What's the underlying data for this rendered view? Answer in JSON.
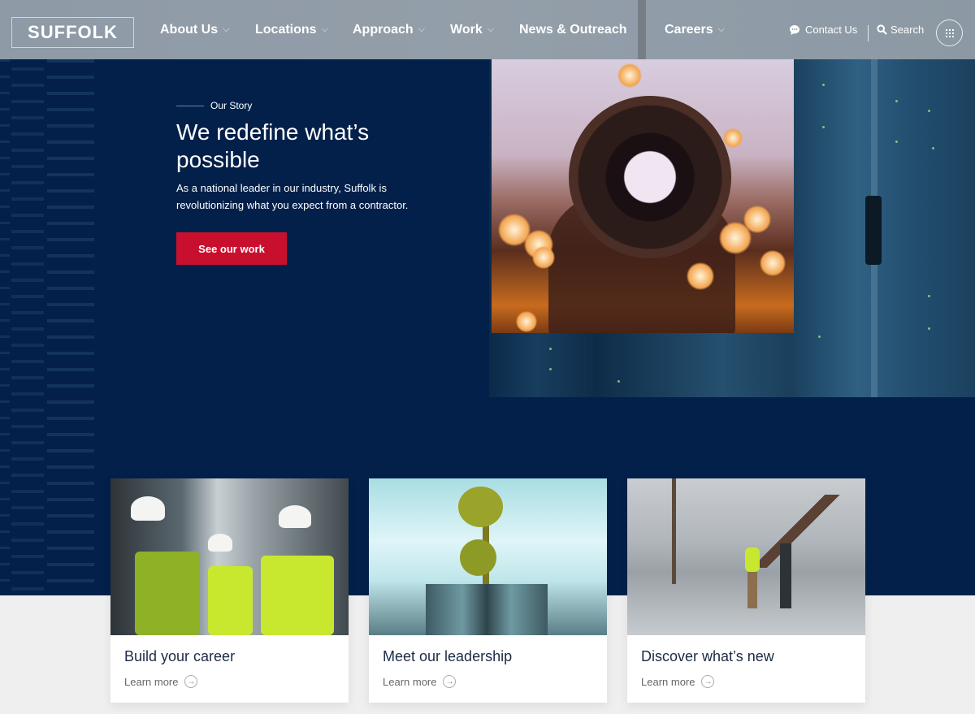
{
  "header": {
    "logo": "SUFFOLK",
    "nav": [
      {
        "label": "About Us",
        "has_dropdown": true
      },
      {
        "label": "Locations",
        "has_dropdown": true
      },
      {
        "label": "Approach",
        "has_dropdown": true
      },
      {
        "label": "Work",
        "has_dropdown": true
      },
      {
        "label": "News & Outreach",
        "has_dropdown": false
      },
      {
        "label": "Careers",
        "has_dropdown": true
      }
    ],
    "contact_label": "Contact Us",
    "search_label": "Search",
    "chevron": "⌵",
    "icons": {
      "contact": "chat-bubble-icon",
      "search": "search-icon",
      "menu": "grid-menu-icon"
    }
  },
  "hero": {
    "eyebrow": "Our Story",
    "headline": "We redefine what’s possible",
    "body": "As a national leader in our industry, Suffolk is revolutionizing what you expect from a contractor.",
    "cta_label": "See our work"
  },
  "cards": [
    {
      "title": "Build your career",
      "link": "Learn more",
      "image": "construction workers in hard hats and safety vests"
    },
    {
      "title": "Meet our leadership",
      "link": "Learn more",
      "image": "escalators beneath glass atrium with golden flower sculpture"
    },
    {
      "title": "Discover what’s new",
      "link": "Learn more",
      "image": "two workers talking at construction site"
    }
  ],
  "colors": {
    "navy": "#03204a",
    "cta_red": "#c8102e",
    "light_bg": "#efefef"
  }
}
